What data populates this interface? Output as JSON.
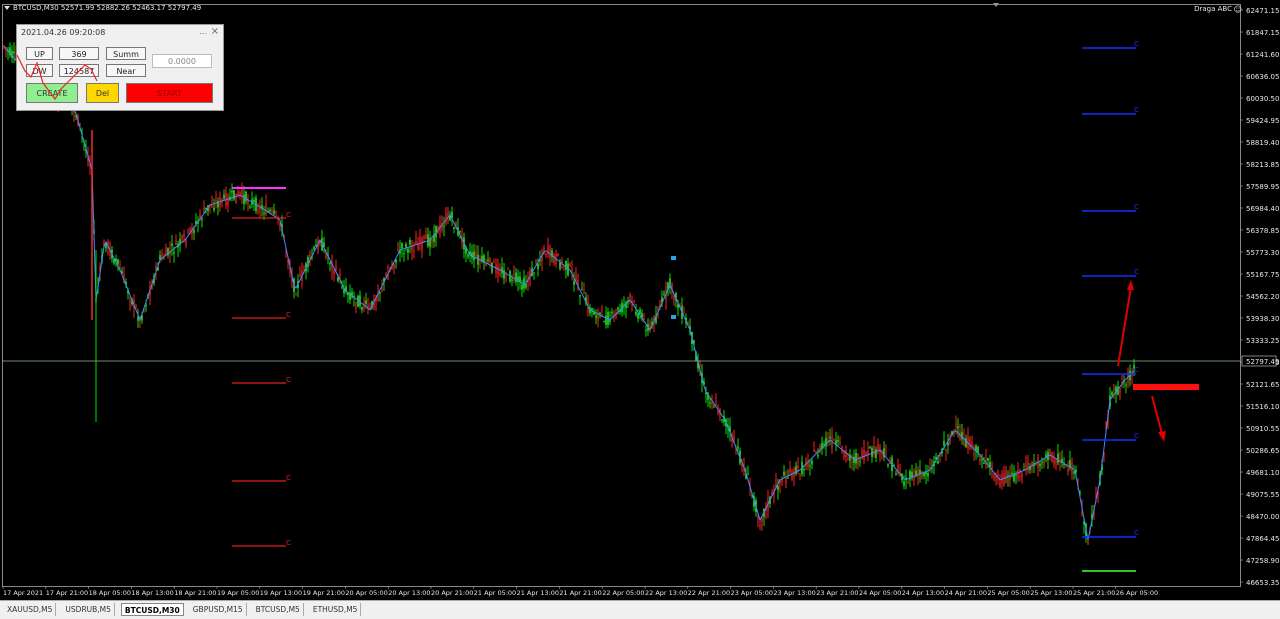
{
  "chart": {
    "header": "BTCUSD,M30  52571.99 52882.26 52463.17 52797.49",
    "indicator_name": "Draga ABC",
    "current_price": "52797.49",
    "colors": {
      "background": "#000000",
      "bull": "#00ff00",
      "bear": "#ff0000",
      "wick": "#2288ff",
      "ma": "#4aa3ff"
    }
  },
  "y_axis_labels": [
    "62471.15",
    "61847.15",
    "61241.60",
    "60636.05",
    "60030.50",
    "59424.95",
    "58819.40",
    "58213.85",
    "57589.95",
    "56984.40",
    "56378.85",
    "55773.30",
    "55167.75",
    "54562.20",
    "53938.30",
    "53333.25",
    "52727.45",
    "52121.65",
    "51516.10",
    "50910.55",
    "50286.65",
    "49681.10",
    "49075.55",
    "48470.00",
    "47864.45",
    "47258.90",
    "46653.35"
  ],
  "x_axis_labels": [
    "17 Apr 2021",
    "17 Apr 21:00",
    "18 Apr 05:00",
    "18 Apr 13:00",
    "18 Apr 21:00",
    "19 Apr 05:00",
    "19 Apr 13:00",
    "19 Apr 21:00",
    "20 Apr 05:00",
    "20 Apr 13:00",
    "20 Apr 21:00",
    "21 Apr 05:00",
    "21 Apr 13:00",
    "21 Apr 21:00",
    "22 Apr 05:00",
    "22 Apr 13:00",
    "22 Apr 21:00",
    "23 Apr 05:00",
    "23 Apr 13:00",
    "23 Apr 21:00",
    "24 Apr 05:00",
    "24 Apr 13:00",
    "24 Apr 21:00",
    "25 Apr 05:00",
    "25 Apr 13:00",
    "25 Apr 21:00",
    "26 Apr 05:00"
  ],
  "level_marks": {
    "left": [
      "C",
      "C",
      "C",
      "C",
      "C"
    ],
    "right": [
      "C",
      "C",
      "C",
      "C",
      "C",
      "C",
      "C"
    ]
  },
  "panel": {
    "timestamp": "2021.04.26 09:20:08",
    "minimize": "...",
    "close": "×",
    "up_label": "UP",
    "up_value": "369",
    "dw_label": "DW",
    "dw_value": "124587",
    "summ_label": "Summ",
    "near_label": "Near",
    "price_input": "0.0000",
    "create_label": "CREATE",
    "del_label": "Del",
    "start_label": "START"
  },
  "tabs": [
    "XAUUSD,M5",
    "USDRUB,M5",
    "BTCUSD,M30",
    "GBPUSD,M15",
    "BTCUSD,M5",
    "ETHUSD,M5"
  ],
  "active_tab_index": 2
}
